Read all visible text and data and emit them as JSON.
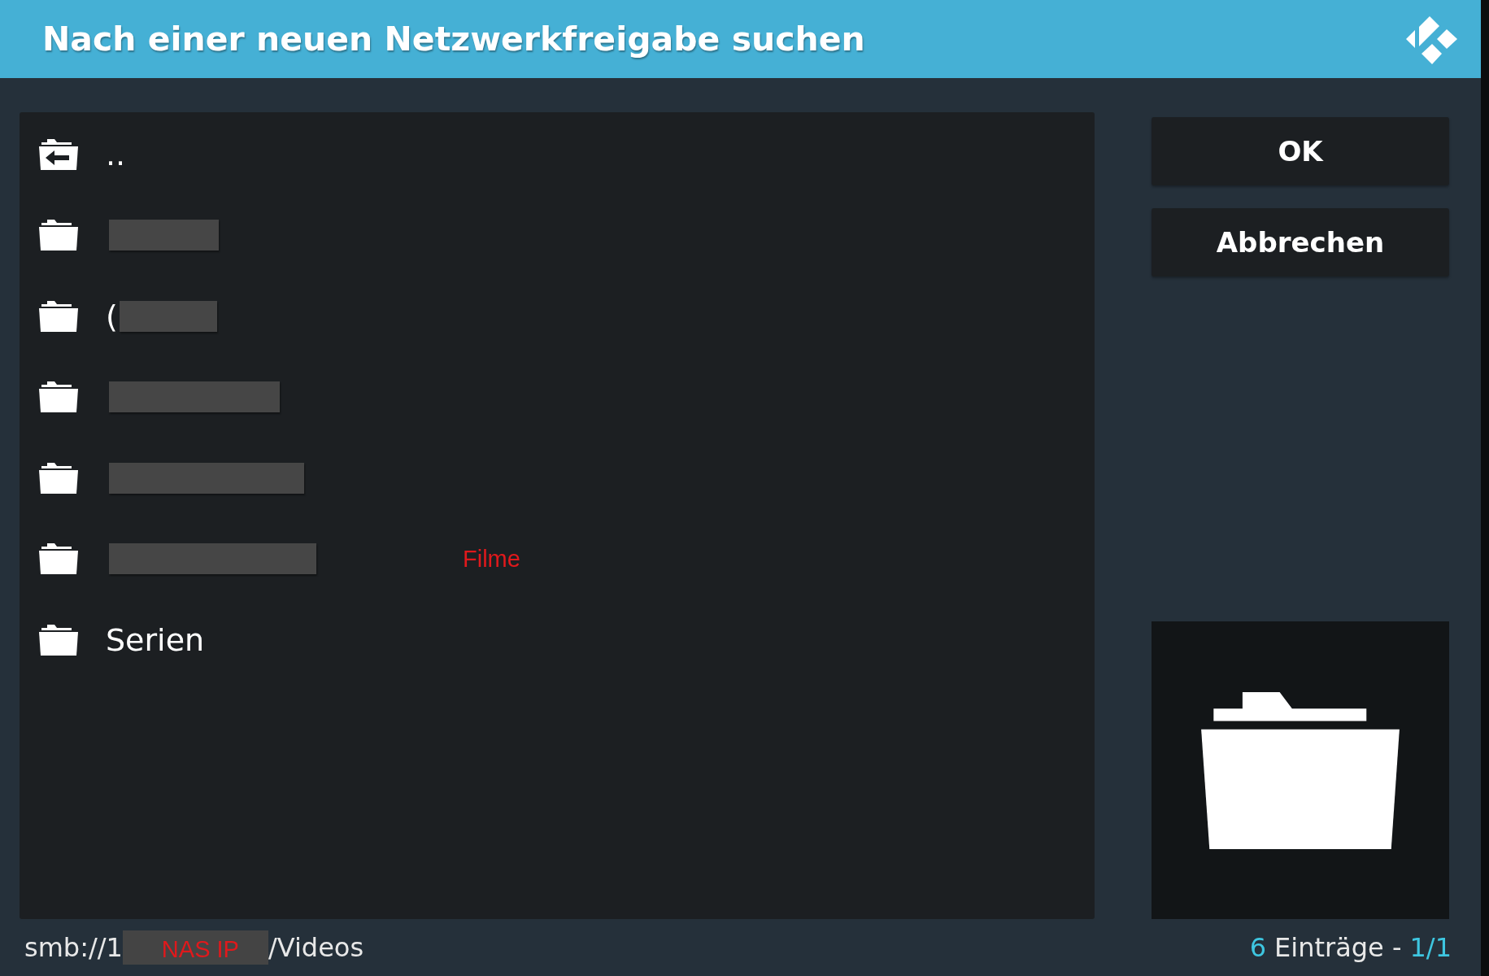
{
  "window": {
    "title": "Nach einer neuen Netzwerkfreigabe suchen"
  },
  "items": [
    {
      "kind": "parent",
      "label": ".."
    },
    {
      "kind": "redacted"
    },
    {
      "kind": "redacted",
      "label": "("
    },
    {
      "kind": "redacted"
    },
    {
      "kind": "redacted"
    },
    {
      "kind": "redacted",
      "annotation": "Filme"
    },
    {
      "kind": "folder",
      "label": "Serien"
    }
  ],
  "buttons": [
    {
      "label": "OK"
    },
    {
      "label": "Abbrechen"
    }
  ],
  "status_bar": {
    "path_start": "smb://1",
    "redaction_label": "NAS IP",
    "path_end": "/Videos",
    "count": "6",
    "count_label": "Einträge -",
    "page": "1/1"
  }
}
